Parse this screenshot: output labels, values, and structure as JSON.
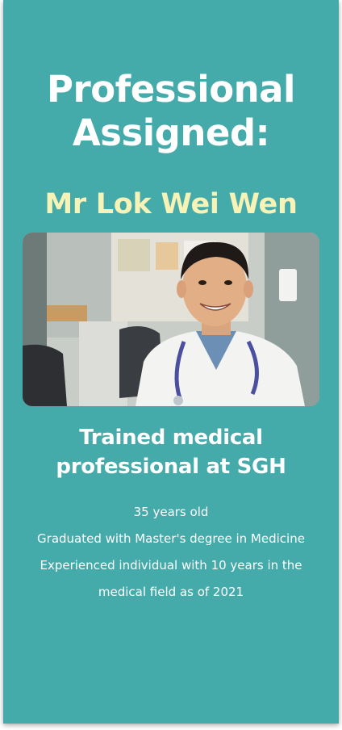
{
  "card": {
    "title_line1": "Professional",
    "title_line2": "Assigned:",
    "professional_name": "Mr Lok Wei Wen",
    "subtitle_line1": "Trained medical",
    "subtitle_line2": "professional at SGH",
    "details": {
      "age": "35 years old",
      "education": "Graduated with Master's degree in Medicine",
      "experience": "Experienced individual with 10 years in the medical field as of 2021"
    },
    "colors": {
      "background": "#45aaaa",
      "name": "#f7f2b6",
      "text": "#ffffff"
    }
  }
}
